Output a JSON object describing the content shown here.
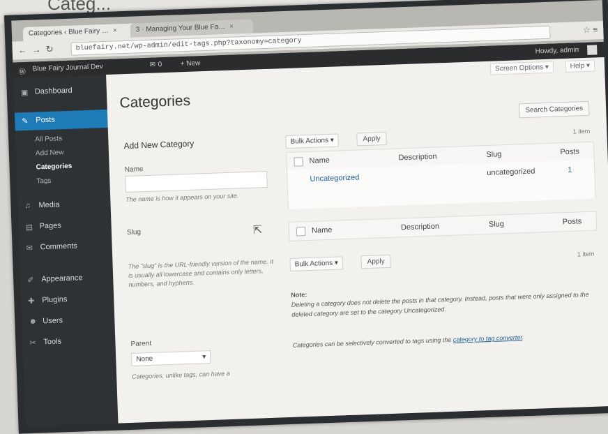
{
  "page_header_text": "Categ...",
  "browser": {
    "tabs": [
      {
        "label": "Categories ‹ Blue Fairy …",
        "active": true
      },
      {
        "label": "3 · Managing Your Blue Fa…",
        "active": false
      }
    ],
    "url": "bluefairy.net/wp-admin/edit-tags.php?taxonomy=category",
    "close_glyph": "×"
  },
  "adminbar": {
    "site_name": "Blue Fairy Journal Dev",
    "comments_count": "0",
    "new_label": "+ New",
    "howdy": "Howdy, admin"
  },
  "sidebar": {
    "items": [
      {
        "label": "Dashboard",
        "icon": "dashboard-icon",
        "glyph": "▣"
      },
      {
        "label": "Posts",
        "icon": "pin-icon",
        "glyph": "✎",
        "active": true
      },
      {
        "label": "All Posts",
        "sub": true
      },
      {
        "label": "Add New",
        "sub": true
      },
      {
        "label": "Categories",
        "sub": true,
        "current": true
      },
      {
        "label": "Tags",
        "sub": true
      },
      {
        "label": "Media",
        "icon": "media-icon",
        "glyph": "♫"
      },
      {
        "label": "Pages",
        "icon": "pages-icon",
        "glyph": "▤"
      },
      {
        "label": "Comments",
        "icon": "comments-icon",
        "glyph": "✉"
      },
      {
        "label": "Appearance",
        "icon": "appearance-icon",
        "glyph": "✐"
      },
      {
        "label": "Plugins",
        "icon": "plugins-icon",
        "glyph": "✚"
      },
      {
        "label": "Users",
        "icon": "users-icon",
        "glyph": "☻"
      },
      {
        "label": "Tools",
        "icon": "tools-icon",
        "glyph": "✂"
      }
    ]
  },
  "top_links": {
    "screen_options": "Screen Options ▾",
    "help": "Help ▾"
  },
  "main": {
    "title": "Categories",
    "search_button": "Search Categories",
    "add_new": {
      "heading": "Add New Category",
      "name_label": "Name",
      "name_value": "",
      "name_help": "The name is how it appears on your site.",
      "slug_label": "Slug",
      "slug_help": "The “slug” is the URL-friendly version of the name. It is usually all lowercase and contains only letters, numbers, and hyphens.",
      "parent_label": "Parent",
      "parent_value": "None",
      "parent_help": "Categories, unlike tags, can have a"
    },
    "bulk_actions": "Bulk Actions",
    "apply": "Apply",
    "items_count": "1 item",
    "columns": [
      "Name",
      "Description",
      "Slug",
      "Posts"
    ],
    "rows": [
      {
        "name": "Uncategorized",
        "description": "",
        "slug": "uncategorized",
        "posts": "1"
      }
    ],
    "note_title": "Note:",
    "note_text": "Deleting a category does not delete the posts in that category. Instead, posts that were only assigned to the deleted category are set to the category Uncategorized.",
    "convert_text": "Categories can be selectively converted to tags using the",
    "convert_link": "category to tag converter",
    "convert_end": "."
  },
  "colors": {
    "sidebar_bg": "#2f3235",
    "active_menu": "#1f7ab8",
    "content_bg": "#f2f1ee"
  }
}
